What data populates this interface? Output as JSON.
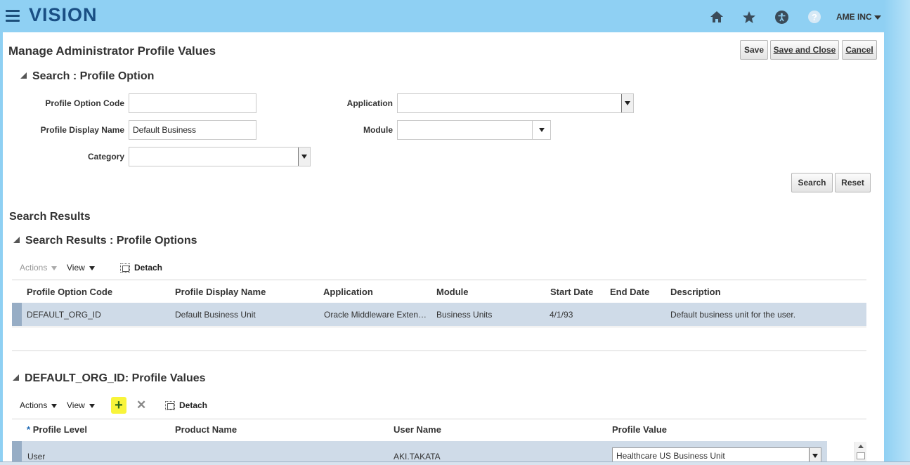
{
  "header": {
    "logo": "VISION",
    "user_menu": "AME INC",
    "icons": [
      "menu-icon",
      "home-icon",
      "star-icon",
      "accessibility-icon",
      "help-icon"
    ],
    "help_glyph": "?"
  },
  "page": {
    "title": "Manage Administrator Profile Values",
    "buttons": {
      "save": "Save",
      "save_close": "Save and Close",
      "cancel": "Cancel"
    }
  },
  "search": {
    "title": "Search : Profile Option",
    "fields": {
      "profile_option_code": {
        "label": "Profile Option Code",
        "value": ""
      },
      "profile_display_name": {
        "label": "Profile Display Name",
        "value": "Default Business"
      },
      "category": {
        "label": "Category",
        "value": ""
      },
      "application": {
        "label": "Application",
        "value": ""
      },
      "module": {
        "label": "Module",
        "value": ""
      }
    },
    "buttons": {
      "search": "Search",
      "reset": "Reset"
    }
  },
  "results": {
    "heading": "Search Results",
    "title": "Search Results : Profile Options",
    "toolbar": {
      "actions": "Actions",
      "view": "View",
      "detach": "Detach"
    },
    "columns": [
      "Profile Option Code",
      "Profile Display Name",
      "Application",
      "Module",
      "Start Date",
      "End Date",
      "Description"
    ],
    "rows": [
      [
        "DEFAULT_ORG_ID",
        "Default Business Unit",
        "Oracle Middleware Exten…",
        "Business Units",
        "4/1/93",
        "",
        "Default business unit for the user."
      ]
    ]
  },
  "values": {
    "title": "DEFAULT_ORG_ID: Profile Values",
    "toolbar": {
      "actions": "Actions",
      "view": "View",
      "add_glyph": "+",
      "delete_glyph": "✕",
      "detach": "Detach"
    },
    "required_mark": "*",
    "columns": [
      "Profile Level",
      "Product Name",
      "User Name",
      "Profile Value"
    ],
    "rows": [
      {
        "profile_level": "User",
        "product_name": "",
        "user_name": "AKI.TAKATA",
        "profile_value": "Healthcare US Business Unit"
      }
    ]
  }
}
